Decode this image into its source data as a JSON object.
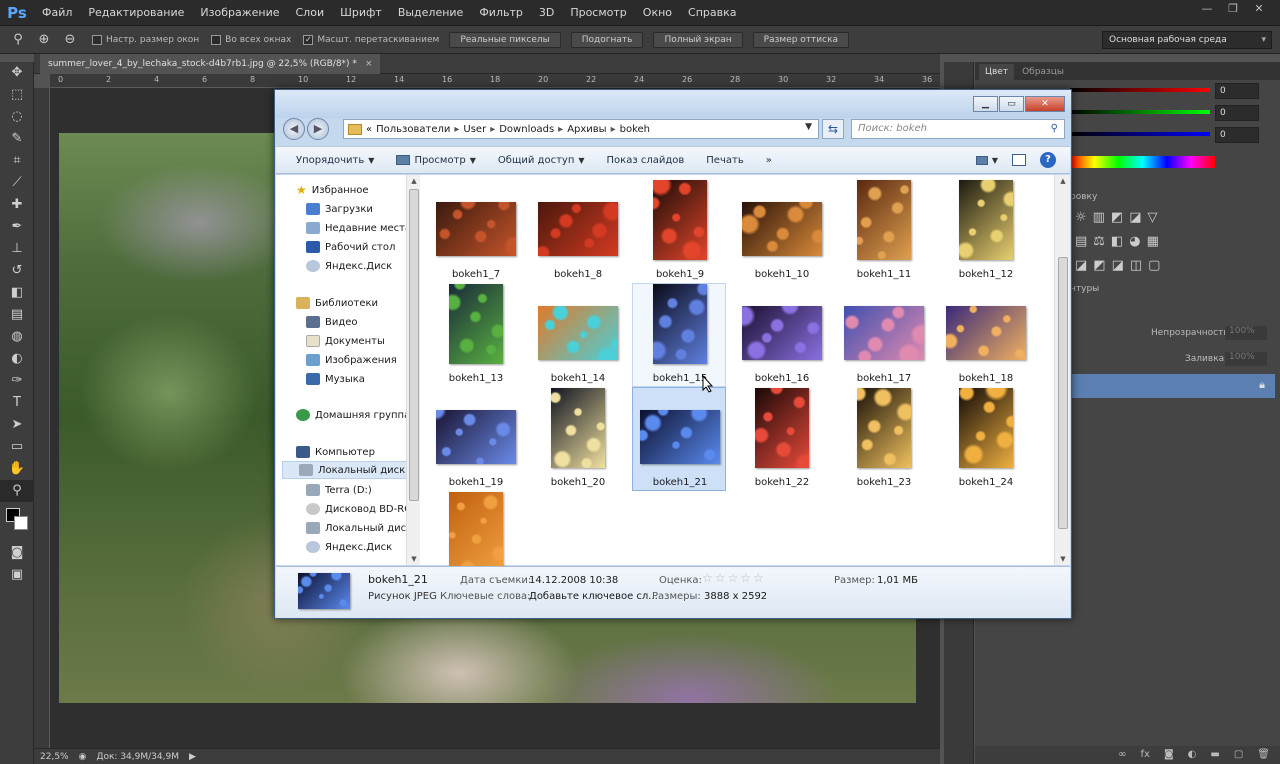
{
  "app": {
    "logo": "Ps",
    "menu": [
      "Файл",
      "Редактирование",
      "Изображение",
      "Слои",
      "Шрифт",
      "Выделение",
      "Фильтр",
      "3D",
      "Просмотр",
      "Окно",
      "Справка"
    ],
    "window_controls": [
      "—",
      "❐",
      "✕"
    ]
  },
  "options_bar": {
    "checkboxes": [
      {
        "label": "Настр. размер окон",
        "checked": false
      },
      {
        "label": "Во всех окнах",
        "checked": false
      },
      {
        "label": "Масшт. перетаскиванием",
        "checked": true
      }
    ],
    "buttons": [
      "Реальные пикселы",
      "Подогнать",
      "Полный экран",
      "Размер оттиска"
    ],
    "workspace": "Основная рабочая среда"
  },
  "document": {
    "tab_title": "summer_lover_4_by_lechaka_stock-d4b7rb1.jpg @ 22,5% (RGB/8*) *",
    "tab_close": "×",
    "ruler_marks": [
      "0",
      "2",
      "4",
      "6",
      "8",
      "10",
      "12",
      "14",
      "16",
      "18",
      "20",
      "22",
      "24",
      "26",
      "28",
      "30",
      "32",
      "34",
      "36"
    ],
    "zoom": "22,5%",
    "doc_size": "Док: 34,9M/34,9M"
  },
  "panels": {
    "tabs": [
      "Цвет",
      "Образцы"
    ],
    "rgb_values": [
      "0",
      "0",
      "0"
    ],
    "adjust_label": "ровку",
    "contours_label": "нтуры",
    "opacity_label": "Непрозрачность:",
    "opacity_value": "100%",
    "fill_label": "Заливка:",
    "fill_value": "100%"
  },
  "explorer": {
    "breadcrumb": [
      "«",
      "Пользователи",
      "User",
      "Downloads",
      "Архивы",
      "bokeh"
    ],
    "search_placeholder": "Поиск: bokeh",
    "commands": [
      "Упорядочить",
      "Просмотр",
      "Общий доступ",
      "Показ слайдов",
      "Печать",
      "»"
    ],
    "nav": {
      "favorites_header": "Избранное",
      "favorites": [
        "Загрузки",
        "Недавние места",
        "Рабочий стол",
        "Яндекс.Диск"
      ],
      "libraries_header": "Библиотеки",
      "libraries": [
        "Видео",
        "Документы",
        "Изображения",
        "Музыка"
      ],
      "homegroup": "Домашняя группа",
      "computer_header": "Компьютер",
      "computer": [
        "Локальный диск",
        "Terra (D:)",
        "Дисковод BD-RO",
        "Локальный диск",
        "Яндекс.Диск"
      ]
    },
    "files": [
      {
        "name": "bokeh1_7",
        "c1": "#c4542a",
        "c2": "#3a1a0e",
        "orient": "land"
      },
      {
        "name": "bokeh1_8",
        "c1": "#d43a22",
        "c2": "#4a180c",
        "orient": "land"
      },
      {
        "name": "bokeh1_9",
        "c1": "#e2452a",
        "c2": "#1a0c08",
        "orient": "port"
      },
      {
        "name": "bokeh1_10",
        "c1": "#d98a3a",
        "c2": "#2a1208",
        "orient": "land"
      },
      {
        "name": "bokeh1_11",
        "c1": "#e0a050",
        "c2": "#5a2810",
        "orient": "port"
      },
      {
        "name": "bokeh1_12",
        "c1": "#e8d070",
        "c2": "#1c1a10",
        "orient": "port"
      },
      {
        "name": "bokeh1_13",
        "c1": "#58b040",
        "c2": "#1a2a3a",
        "orient": "port"
      },
      {
        "name": "bokeh1_14",
        "c1": "#4ad0d8",
        "c2": "#e07a2a",
        "orient": "land"
      },
      {
        "name": "bokeh1_15",
        "c1": "#6080e0",
        "c2": "#0a0a18",
        "orient": "port"
      },
      {
        "name": "bokeh1_16",
        "c1": "#8a70e0",
        "c2": "#1a1030",
        "orient": "land"
      },
      {
        "name": "bokeh1_17",
        "c1": "#e08ab0",
        "c2": "#4050b0",
        "orient": "land"
      },
      {
        "name": "bokeh1_18",
        "c1": "#f0b060",
        "c2": "#3a2a7a",
        "orient": "land"
      },
      {
        "name": "bokeh1_19",
        "c1": "#6a8ae8",
        "c2": "#1a1432",
        "orient": "land"
      },
      {
        "name": "bokeh1_20",
        "c1": "#f0e0a0",
        "c2": "#101420",
        "orient": "port"
      },
      {
        "name": "bokeh1_21",
        "c1": "#5a8aee",
        "c2": "#0c1030",
        "orient": "land"
      },
      {
        "name": "bokeh1_22",
        "c1": "#e84a3a",
        "c2": "#1a0808",
        "orient": "port"
      },
      {
        "name": "bokeh1_23",
        "c1": "#f0c060",
        "c2": "#1a1208",
        "orient": "port"
      },
      {
        "name": "bokeh1_24",
        "c1": "#f0b040",
        "c2": "#100a08",
        "orient": "port"
      },
      {
        "name": "",
        "c1": "#f0a040",
        "c2": "#c06010",
        "orient": "port"
      }
    ],
    "details": {
      "name": "bokeh1_21",
      "type": "Рисунок JPEG",
      "date_label": "Дата съемки:",
      "date_value": "14.12.2008 10:38",
      "keywords_label": "Ключевые слова:",
      "keywords_value": "Добавьте ключевое сл...",
      "rating_label": "Оценка:",
      "rating_stars": "☆☆☆☆☆",
      "dims_label": "Размеры:",
      "dims_value": "3888 x 2592",
      "size_label": "Размер:",
      "size_value": "1,01 МБ"
    }
  },
  "colors": {
    "accent": "#5a7fb0",
    "selection": "#cde0f7",
    "ps_bg": "#535353"
  }
}
